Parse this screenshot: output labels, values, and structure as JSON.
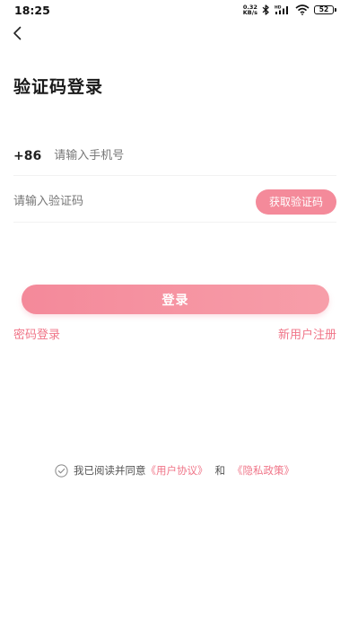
{
  "status_bar": {
    "time": "18:25",
    "net_speed_value": "0.32",
    "net_speed_unit": "KB/s",
    "battery": "52",
    "icons": [
      "bluetooth-icon",
      "hd-signal-icon",
      "wifi-icon",
      "battery-icon"
    ]
  },
  "nav": {
    "back_icon": "back-arrow-icon"
  },
  "title": "验证码登录",
  "phone": {
    "country_code": "+86",
    "placeholder": "请输入手机号",
    "value": ""
  },
  "code": {
    "placeholder": "请输入验证码",
    "value": "",
    "get_code_label": "获取验证码"
  },
  "login_button_label": "登录",
  "password_login_label": "密码登录",
  "register_label": "新用户注册",
  "agreement": {
    "prefix": "我已阅读并同意",
    "user_agreement": "《用户协议》",
    "and": "和",
    "privacy_policy": "《隐私政策》",
    "checked": false
  },
  "colors": {
    "accent": "#f48a9a",
    "link": "#f07588"
  }
}
